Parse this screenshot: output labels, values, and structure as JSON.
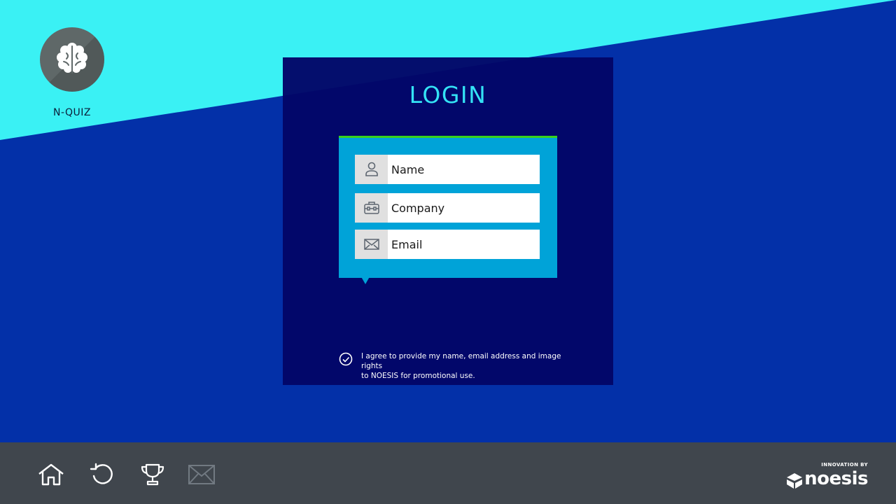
{
  "app": {
    "title": "N-QUIZ",
    "logo_icon": "brain-icon"
  },
  "login": {
    "title": "LOGIN",
    "fields": [
      {
        "placeholder": "Name",
        "icon": "user-icon"
      },
      {
        "placeholder": "Company",
        "icon": "briefcase-icon"
      },
      {
        "placeholder": "Email",
        "icon": "envelope-icon"
      }
    ],
    "consent": {
      "line1": "I agree to provide my name, email address and image rights",
      "line2": "to NOESIS for promotional use."
    }
  },
  "footer": {
    "nav": [
      {
        "icon": "home-icon",
        "enabled": true
      },
      {
        "icon": "restart-icon",
        "enabled": true
      },
      {
        "icon": "trophy-icon",
        "enabled": true
      },
      {
        "icon": "mail-icon",
        "enabled": false
      }
    ],
    "brand": {
      "tagline": "INNOVATION BY",
      "name": "noesis"
    }
  },
  "colors": {
    "background_light": "#3af1f4",
    "background_dark": "#0330a8",
    "panel": "#020668",
    "title": "#34e2f5",
    "form_card": "#00a3d8",
    "form_accent": "#39d21c",
    "footer": "#40464d"
  }
}
